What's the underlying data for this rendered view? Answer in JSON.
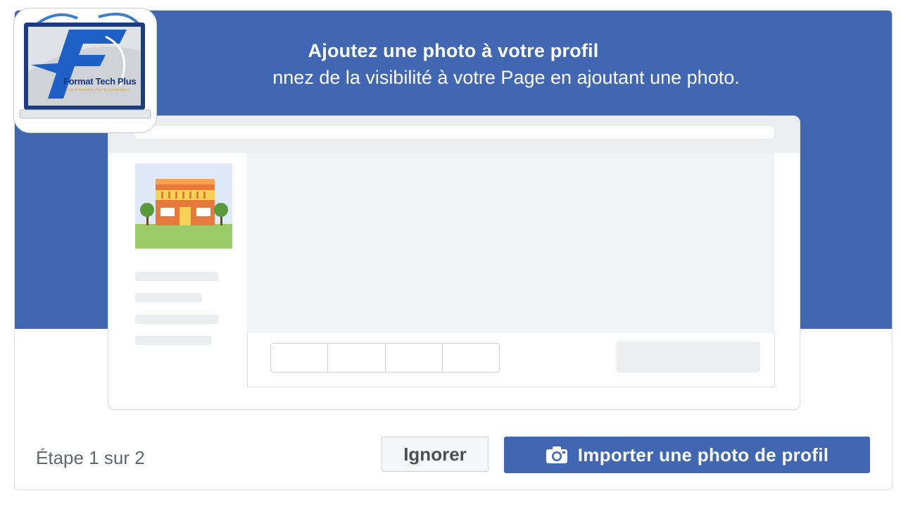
{
  "banner": {
    "title": "Ajoutez une photo à votre profil",
    "subtitle": "nnez de la visibilité à votre Page en ajoutant une photo."
  },
  "footer": {
    "step_text": "Étape 1 sur 2",
    "ignore_label": "Ignorer",
    "import_label": "Importer une photo de profil"
  },
  "logo": {
    "brand_text": "Format Tech Plus",
    "tagline": "Plus de formation, Plus de connaissance"
  },
  "colors": {
    "brand_blue": "#4267b2",
    "light_gray": "#ebedf0"
  },
  "icons": {
    "import_button_icon": "camera-icon"
  }
}
